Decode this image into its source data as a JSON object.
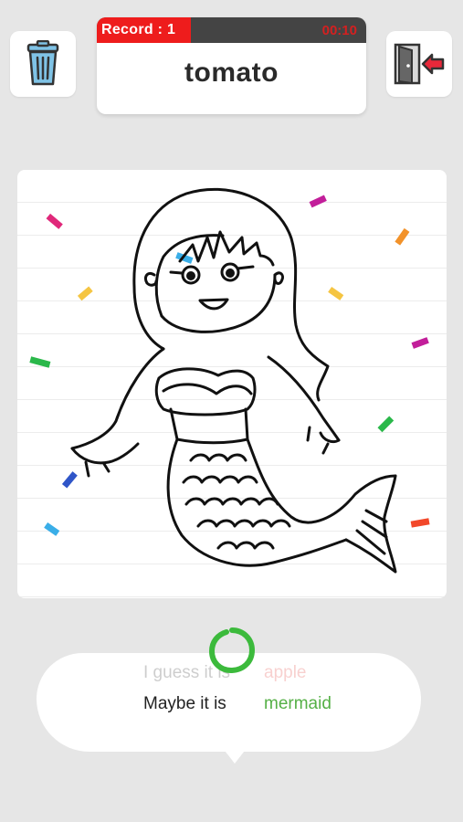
{
  "header": {
    "record_label": "Record : 1",
    "timer": "00:10",
    "timer_progress": 0.35,
    "target_word": "tomato"
  },
  "toolbar": {
    "left_icon": "trash-can-icon",
    "right_icon": "exit-door-icon"
  },
  "colors": {
    "background": "#e6e6e6",
    "record_red": "#ee1c1c",
    "correct_green": "#55b046",
    "wrong_red": "#e0302a",
    "trash_blue": "#7fc3e6",
    "exit_red": "#e8283a"
  },
  "guesses": {
    "previous": {
      "prefix": "I guess it is",
      "word": "apple"
    },
    "current": {
      "prefix": "Maybe it is",
      "word": "mermaid"
    }
  },
  "canvas": {
    "drawing_subject": "mermaid-drawing",
    "confetti_colors": [
      "#e0287a",
      "#f2922a",
      "#f5c542",
      "#2ab84a",
      "#3aaee8",
      "#2f55c8",
      "#c21e9a",
      "#f2482a"
    ]
  }
}
